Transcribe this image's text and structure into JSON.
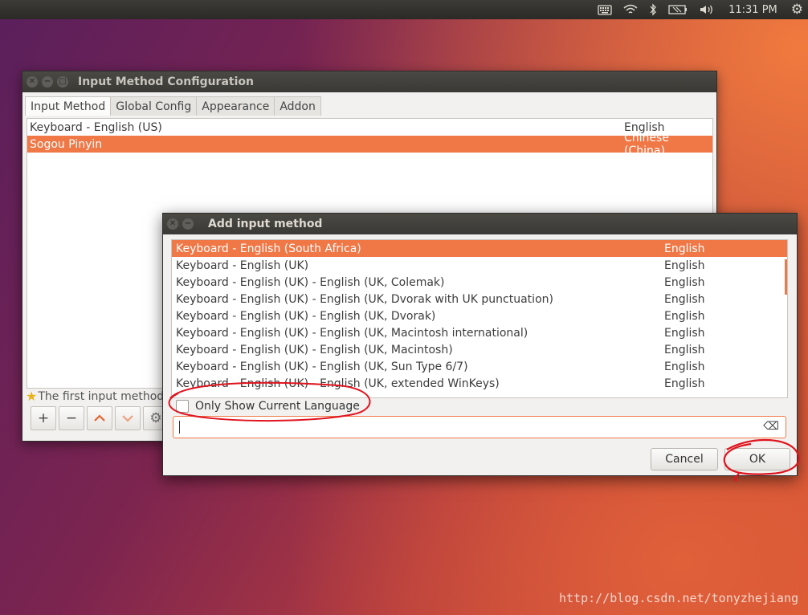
{
  "topbar": {
    "time": "11:31 PM",
    "icons": [
      "keyboard-icon",
      "wifi-icon",
      "bluetooth-icon",
      "battery-icon",
      "volume-icon",
      "gear-icon"
    ]
  },
  "main_window": {
    "title": "Input Method Configuration",
    "tabs": [
      "Input Method",
      "Global Config",
      "Appearance",
      "Addon"
    ],
    "active_tab": "Input Method",
    "rows": [
      {
        "name": "Keyboard - English (US)",
        "lang": "English",
        "selected": false
      },
      {
        "name": "Sogou Pinyin",
        "lang": "Chinese (China)",
        "selected": true
      }
    ],
    "note": "The first input method",
    "toolbar": [
      "+",
      "−",
      "⌃",
      "⌄",
      "⚙"
    ]
  },
  "dialog": {
    "title": "Add input method",
    "rows": [
      {
        "name": "Keyboard - English (South Africa)",
        "lang": "English",
        "selected": true
      },
      {
        "name": "Keyboard - English (UK)",
        "lang": "English",
        "selected": false
      },
      {
        "name": "Keyboard - English (UK) - English (UK, Colemak)",
        "lang": "English",
        "selected": false
      },
      {
        "name": "Keyboard - English (UK) - English (UK, Dvorak with UK punctuation)",
        "lang": "English",
        "selected": false
      },
      {
        "name": "Keyboard - English (UK) - English (UK, Dvorak)",
        "lang": "English",
        "selected": false
      },
      {
        "name": "Keyboard - English (UK) - English (UK, Macintosh international)",
        "lang": "English",
        "selected": false
      },
      {
        "name": "Keyboard - English (UK) - English (UK, Macintosh)",
        "lang": "English",
        "selected": false
      },
      {
        "name": "Keyboard - English (UK) - English (UK, Sun Type 6/7)",
        "lang": "English",
        "selected": false
      },
      {
        "name": "Keyboard - English (UK) - English (UK, extended WinKeys)",
        "lang": "English",
        "selected": false
      }
    ],
    "only_current_label": "Only Show Current Language",
    "only_current_checked": false,
    "search_value": "",
    "cancel_label": "Cancel",
    "ok_label": "OK"
  },
  "watermark": "http://blog.csdn.net/tonyzhejiang",
  "colors": {
    "accent": "#f07746",
    "annotation": "#e0141e"
  }
}
